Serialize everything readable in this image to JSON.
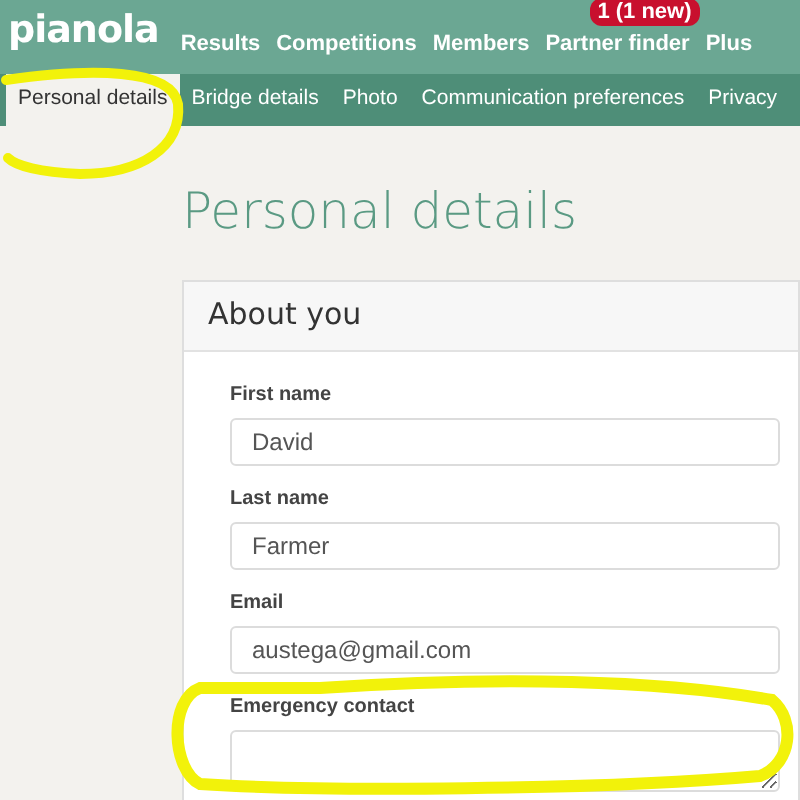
{
  "brand": "pianola",
  "nav": [
    {
      "label": "Results"
    },
    {
      "label": "Competitions"
    },
    {
      "label": "Members"
    },
    {
      "label": "Partner finder",
      "badge": "1 (1 new)"
    },
    {
      "label": "Plus"
    }
  ],
  "tabs": [
    {
      "label": "Personal details",
      "selected": true
    },
    {
      "label": "Bridge details",
      "selected": false
    },
    {
      "label": "Photo",
      "selected": false
    },
    {
      "label": "Communication preferences",
      "selected": false
    },
    {
      "label": "Privacy",
      "selected": false
    }
  ],
  "heading": "Personal details",
  "card": {
    "title": "About you",
    "fields": [
      {
        "label": "First name",
        "value": "David",
        "kind": "input"
      },
      {
        "label": "Last name",
        "value": "Farmer",
        "kind": "input"
      },
      {
        "label": "Email",
        "value": "austega@gmail.com",
        "kind": "input"
      },
      {
        "label": "Emergency contact",
        "kind": "textarea"
      }
    ]
  }
}
